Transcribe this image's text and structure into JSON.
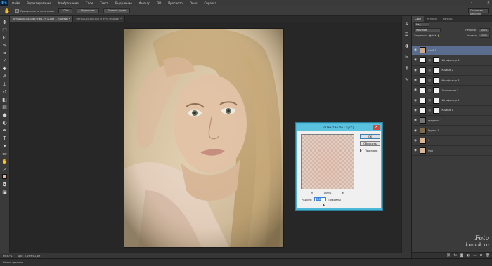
{
  "app": {
    "logo": "Ps"
  },
  "menu": [
    "Файл",
    "Редактирование",
    "Изображение",
    "Слои",
    "Текст",
    "Выделение",
    "Фильтр",
    "3D",
    "Просмотр",
    "Окно",
    "Справка"
  ],
  "options_bar": {
    "checkbox_label": "Пропустить на всех слоях",
    "zoom_field": "100%",
    "fit_button": "Подогнать",
    "fullscreen_button": "Полный экран",
    "workspace": "Основная рабочая среда"
  },
  "tabs": [
    {
      "label": "ретушь-ко-кол.psd @ 66,7% (Слой 1, RGB/8#) *",
      "active": true
    },
    {
      "label": "ретушь-ко-кол.psd @ 39% (RGB/8#) *",
      "active": false
    }
  ],
  "status": {
    "zoom": "66,67%",
    "doc": "Док: 3,49M/11,4M"
  },
  "timeline_label": "Шкала времени",
  "layers_panel": {
    "tabs": [
      "Слои",
      "Истории",
      "Каналы"
    ],
    "kind_label": "Вид",
    "blend_mode": "Обычные",
    "opacity_label": "Непрозр.:",
    "opacity_value": "100%",
    "lock_label": "Закрепить:",
    "fill_label": "Заливка:",
    "fill_value": "100%",
    "layers": [
      {
        "name": "Слой 1",
        "selected": true,
        "thumb": "#cfab8a",
        "mask": false,
        "chain": false
      },
      {
        "name": "Фотофильтр 4",
        "selected": false,
        "thumb": "#f4f4f4",
        "mask": true,
        "chain": true
      },
      {
        "name": "Кривые 2",
        "selected": false,
        "thumb": "#f4f4f4",
        "mask": true,
        "chain": true
      },
      {
        "name": "Фотофильтр 3",
        "selected": false,
        "thumb": "#f4f4f4",
        "mask": true,
        "chain": true
      },
      {
        "name": "Экспозиция 1",
        "selected": false,
        "thumb": "#f4f4f4",
        "mask": true,
        "chain": true
      },
      {
        "name": "Фотофильтр 2",
        "selected": false,
        "thumb": "#f4f4f4",
        "mask": true,
        "chain": true
      },
      {
        "name": "Кривые 1",
        "selected": false,
        "thumb": "#f4f4f4",
        "mask": true,
        "chain": true
      },
      {
        "name": "градиент 1",
        "selected": false,
        "thumb": "#777777",
        "mask": false,
        "chain": false
      },
      {
        "name": "Группа 1",
        "selected": false,
        "thumb": "#7f6a4e",
        "mask": false,
        "chain": false
      },
      {
        "name": "1",
        "selected": false,
        "thumb": "#dcb794",
        "mask": false,
        "chain": false
      },
      {
        "name": "Фон",
        "selected": false,
        "thumb": "#d9b897",
        "mask": false,
        "chain": false
      }
    ]
  },
  "dialog": {
    "title": "Размытие по Гауссу",
    "ok": "OK",
    "reset": "Сбросить",
    "preview_label": "Просмотр",
    "zoom": "100%",
    "radius_label": "Радиус:",
    "radius_value": "5,0",
    "unit": "Пикселы"
  },
  "watermark": {
    "line1": "Foto",
    "line2": "komok.ru"
  }
}
